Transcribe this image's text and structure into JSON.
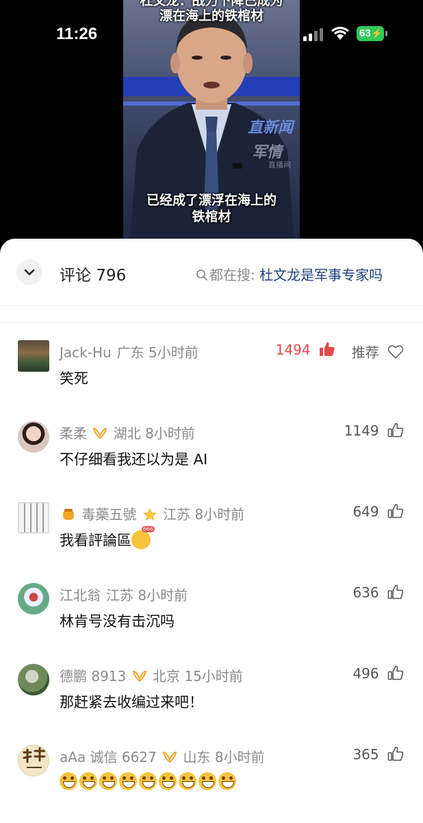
{
  "status_bar": {
    "time": "11:26",
    "battery": "63"
  },
  "video": {
    "caption_top_line1": "杜文龙：战力下降已成为",
    "caption_top_line2": "漂在海上的铁棺材",
    "caption_bottom_line1": "已经成了漂浮在海上的",
    "caption_bottom_line2": "铁棺材",
    "watermark1": "直新闻",
    "watermark2": "军情",
    "watermark3": "直播间"
  },
  "header": {
    "title": "评论 796",
    "search_prefix": "都在搜: ",
    "search_term": "杜文龙是军事专家吗"
  },
  "comments": [
    {
      "user": "Jack-Hu",
      "region": "广东",
      "time": "5小时前",
      "text": "笑死",
      "likes": "1494",
      "hot": true,
      "recommend": "推荐"
    },
    {
      "user": "柔柔",
      "region": "湖北",
      "time": "8小时前",
      "text": "不仔细看我还以为是 AI",
      "likes": "1149"
    },
    {
      "user": "毒藥五號",
      "region": "江苏",
      "time": "8小时前",
      "text": "我看評論區",
      "likes": "649"
    },
    {
      "user": "江北翁",
      "region": "江苏",
      "time": "8小时前",
      "text": "林肯号没有击沉吗",
      "likes": "636"
    },
    {
      "user": "德鹏 8913",
      "region": "北京",
      "time": "15小时前",
      "text": "那赶紧去收编过来吧！",
      "likes": "496"
    },
    {
      "user": "aAa 诚信 6627",
      "region": "山东",
      "time": "8小时前",
      "text": "",
      "likes": "365",
      "emoji_count": 9
    }
  ],
  "colors": {
    "hot_like": "#e5484d",
    "search_term": "#1e3f80",
    "battery": "#34c759"
  }
}
